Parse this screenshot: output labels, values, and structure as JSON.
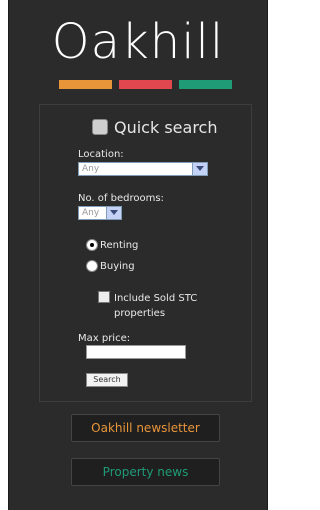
{
  "brand": {
    "logo_text": "Oakhill",
    "bar_colors": [
      "#e8953a",
      "#e0474f",
      "#1f9b76"
    ]
  },
  "quick_search": {
    "title": "Quick search",
    "location_label": "Location:",
    "location_value": "Any",
    "bedrooms_label": "No. of bedrooms:",
    "bedrooms_value": "Any",
    "radio_renting": "Renting",
    "radio_buying": "Buying",
    "selected_option": "Renting",
    "include_sold_label": "Include Sold STC properties",
    "include_sold_checked": false,
    "max_price_label": "Max price:",
    "max_price_value": "",
    "search_label": "Search"
  },
  "buttons": {
    "newsletter": "Oakhill newsletter",
    "newsletter_color": "#e8953a",
    "property_news": "Property news",
    "property_news_color": "#1f9b76"
  }
}
